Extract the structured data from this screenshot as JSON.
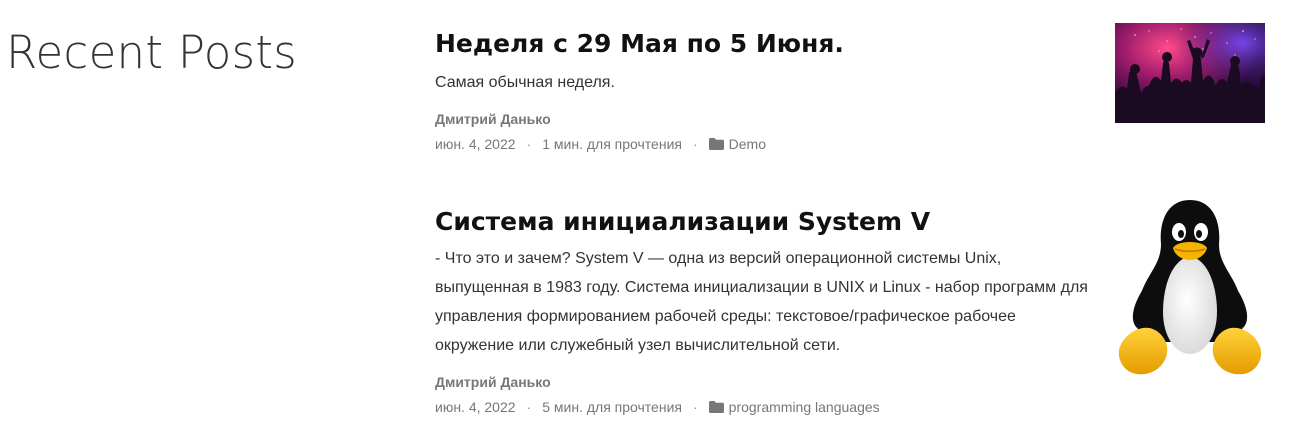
{
  "section": {
    "title": "Recent Posts"
  },
  "posts": [
    {
      "title": "Неделя с 29 Мая по 5 Июня.",
      "excerpt": "Самая обычная неделя.",
      "author": "Дмитрий Данько",
      "date": "июн. 4, 2022",
      "separator": "·",
      "read_time": "1 мин. для прочтения",
      "category": "Demo",
      "thumbnail_icon": "party-crowd-image"
    },
    {
      "title": "Система инициализации System V",
      "excerpt": "- Что это и зачем? System V — одна из версий операционной системы Unix, выпущенная в 1983 году. Система инициализации в UNIX и Linux - набор программ для управления формированием рабочей среды: текстовое/графическое рабочее окружение или служебный узел вычислительной сети.",
      "author": "Дмитрий Данько",
      "date": "июн. 4, 2022",
      "separator": "·",
      "read_time": "5 мин. для прочтения",
      "category": "programming languages",
      "thumbnail_icon": "tux-penguin-image"
    }
  ],
  "colors": {
    "title_text": "#111111",
    "body_text": "#333333",
    "meta_text": "#777777",
    "background": "#ffffff"
  }
}
